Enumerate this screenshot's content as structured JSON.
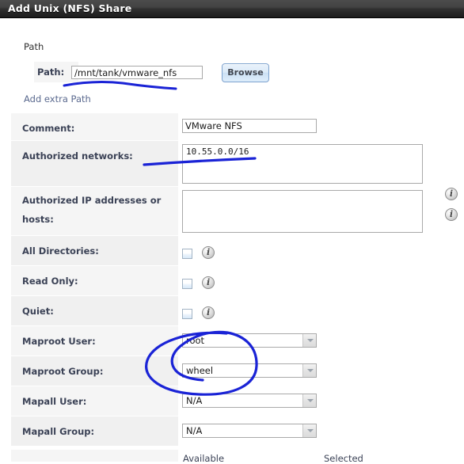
{
  "window": {
    "title": "Add Unix (NFS) Share"
  },
  "path_section": {
    "heading": "Path",
    "path_label": "Path:",
    "path_value": "/mnt/tank/vmware_nfs",
    "path_placeholder": "",
    "browse_label": "Browse",
    "add_extra_link": "Add extra Path"
  },
  "form": {
    "rows": [
      {
        "label": "Comment:",
        "type": "text",
        "value": "VMware NFS",
        "info": false
      },
      {
        "label": "Authorized networks:",
        "type": "textarea",
        "value": "10.55.0.0/16",
        "info": true
      },
      {
        "label": "Authorized IP addresses or hosts:",
        "type": "textarea",
        "value": "",
        "info": true
      },
      {
        "label": "All Directories:",
        "type": "checkbox",
        "checked": false,
        "info": true
      },
      {
        "label": "Read Only:",
        "type": "checkbox",
        "checked": false,
        "info": true
      },
      {
        "label": "Quiet:",
        "type": "checkbox",
        "checked": false,
        "info": true
      },
      {
        "label": "Maproot User:",
        "type": "select",
        "value": "root",
        "info": false
      },
      {
        "label": "Maproot Group:",
        "type": "select",
        "value": "wheel",
        "info": false
      },
      {
        "label": "Mapall User:",
        "type": "select",
        "value": "N/A",
        "info": false
      },
      {
        "label": "Mapall Group:",
        "type": "select",
        "value": "N/A",
        "info": false
      }
    ]
  },
  "labels": {
    "comment": "Comment:",
    "authorized_networks": "Authorized networks:",
    "authorized_hosts_line1": "Authorized IP addresses or",
    "authorized_hosts_line2": "hosts:",
    "all_directories": "All Directories:",
    "read_only": "Read Only:",
    "quiet": "Quiet:",
    "maproot_user": "Maproot User:",
    "maproot_group": "Maproot Group:",
    "mapall_user": "Mapall User:",
    "mapall_group": "Mapall Group:"
  },
  "values": {
    "comment": "VMware NFS",
    "authorized_networks": "10.55.0.0/16",
    "authorized_hosts": "",
    "maproot_user": "root",
    "maproot_group": "wheel",
    "mapall_user": "N/A",
    "mapall_group": "N/A"
  },
  "dual_list": {
    "available_header": "Available",
    "selected_header": "Selected"
  },
  "icons": {
    "info": "i"
  },
  "colors": {
    "titlebar_dark": "#303030",
    "label_bg": "#f5f5f5",
    "label_text": "#3b4256",
    "link": "#5b6a8f",
    "annotation_blue": "#1a23d6",
    "button_border": "#7da2ce"
  }
}
